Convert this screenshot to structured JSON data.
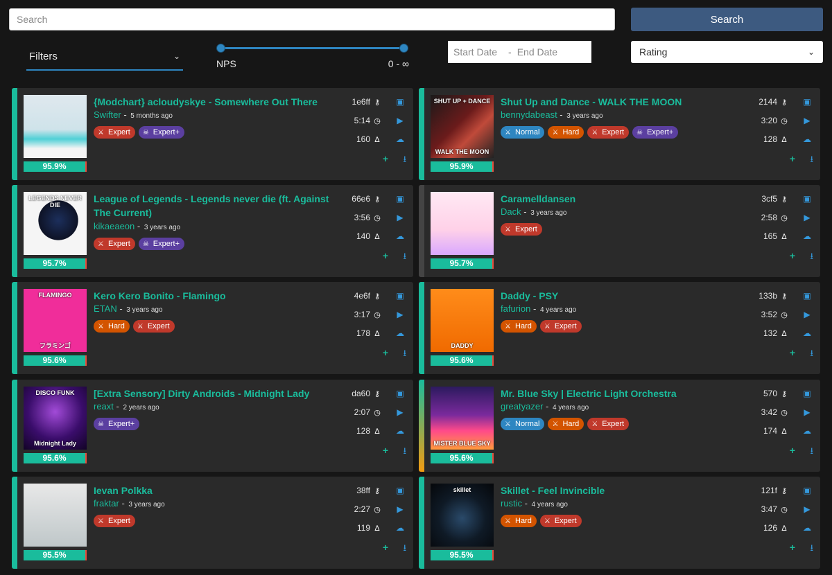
{
  "search": {
    "placeholder": "Search",
    "button_label": "Search"
  },
  "filters": {
    "label": "Filters"
  },
  "nps": {
    "label": "NPS",
    "range_text": "0 - ∞"
  },
  "dates": {
    "start_placeholder": "Start Date",
    "separator": "-",
    "end_placeholder": "End Date"
  },
  "sort": {
    "selected": "Rating"
  },
  "colors": {
    "accent": "#1abc9c",
    "link_blue": "#3498db",
    "search_button": "#3d5a80"
  },
  "maps": [
    {
      "title": "{Modchart} acloudyskye - Somewhere Out There",
      "mapper": "Swifter",
      "age": "5 months ago",
      "key": "1e6ff",
      "duration": "5:14",
      "bpm": "160",
      "rating": "95.9%",
      "rating_fraction": 0.959,
      "difficulties": [
        {
          "label": "Expert",
          "type": "Expert"
        },
        {
          "label": "Expert+",
          "type": "ExpertPlus"
        }
      ]
    },
    {
      "title": "Shut Up and Dance - WALK THE MOON",
      "mapper": "bennydabeast",
      "age": "3 years ago",
      "key": "2144",
      "duration": "3:20",
      "bpm": "128",
      "rating": "95.9%",
      "rating_fraction": 0.959,
      "difficulties": [
        {
          "label": "Normal",
          "type": "Normal"
        },
        {
          "label": "Hard",
          "type": "Hard"
        },
        {
          "label": "Expert",
          "type": "Expert"
        },
        {
          "label": "Expert+",
          "type": "ExpertPlus"
        }
      ]
    },
    {
      "title": "League of Legends - Legends never die (ft. Against The Current)",
      "mapper": "kikaeaeon",
      "age": "3 years ago",
      "key": "66e6",
      "duration": "3:56",
      "bpm": "140",
      "rating": "95.7%",
      "rating_fraction": 0.957,
      "difficulties": [
        {
          "label": "Expert",
          "type": "Expert"
        },
        {
          "label": "Expert+",
          "type": "ExpertPlus"
        }
      ]
    },
    {
      "title": "Caramelldansen",
      "mapper": "Dack",
      "age": "3 years ago",
      "key": "3cf5",
      "duration": "2:58",
      "bpm": "165",
      "rating": "95.7%",
      "rating_fraction": 0.957,
      "difficulties": [
        {
          "label": "Expert",
          "type": "Expert"
        }
      ]
    },
    {
      "title": "Kero Kero Bonito - Flamingo",
      "mapper": "ETAN",
      "age": "3 years ago",
      "key": "4e6f",
      "duration": "3:17",
      "bpm": "178",
      "rating": "95.6%",
      "rating_fraction": 0.956,
      "difficulties": [
        {
          "label": "Hard",
          "type": "Hard"
        },
        {
          "label": "Expert",
          "type": "Expert"
        }
      ]
    },
    {
      "title": "Daddy - PSY",
      "mapper": "fafurion",
      "age": "4 years ago",
      "key": "133b",
      "duration": "3:52",
      "bpm": "132",
      "rating": "95.6%",
      "rating_fraction": 0.956,
      "difficulties": [
        {
          "label": "Hard",
          "type": "Hard"
        },
        {
          "label": "Expert",
          "type": "Expert"
        }
      ]
    },
    {
      "title": "[Extra Sensory] Dirty Androids - Midnight Lady",
      "mapper": "reaxt",
      "age": "2 years ago",
      "key": "da60",
      "duration": "2:07",
      "bpm": "128",
      "rating": "95.6%",
      "rating_fraction": 0.956,
      "difficulties": [
        {
          "label": "Expert+",
          "type": "ExpertPlus"
        }
      ]
    },
    {
      "title": "Mr. Blue Sky | Electric Light Orchestra",
      "mapper": "greatyazer",
      "age": "4 years ago",
      "key": "570",
      "duration": "3:42",
      "bpm": "174",
      "rating": "95.6%",
      "rating_fraction": 0.956,
      "difficulties": [
        {
          "label": "Normal",
          "type": "Normal"
        },
        {
          "label": "Hard",
          "type": "Hard"
        },
        {
          "label": "Expert",
          "type": "Expert"
        }
      ]
    },
    {
      "title": "Ievan Polkka",
      "mapper": "fraktar",
      "age": "3 years ago",
      "key": "38ff",
      "duration": "2:27",
      "bpm": "119",
      "rating": "95.5%",
      "rating_fraction": 0.955,
      "difficulties": [
        {
          "label": "Expert",
          "type": "Expert"
        }
      ]
    },
    {
      "title": "Skillet - Feel Invincible",
      "mapper": "rustic",
      "age": "4 years ago",
      "key": "121f",
      "duration": "3:47",
      "bpm": "126",
      "rating": "95.5%",
      "rating_fraction": 0.955,
      "difficulties": [
        {
          "label": "Hard",
          "type": "Hard"
        },
        {
          "label": "Expert",
          "type": "Expert"
        }
      ]
    }
  ],
  "covers": [
    {
      "bg": "linear-gradient(#dfe8ee 0%, #cfe3ea 55%, #4fd0d6 70%, #f4f4f4 85%)"
    },
    {
      "bg": "linear-gradient(135deg, #1a1a1a 0%, #6b1b1b 45%, #c04a3a 65%, #222 100%)",
      "text": "SHUT UP + DANCE",
      "text2": "WALK THE MOON"
    },
    {
      "bg": "radial-gradient(circle at 55% 45%, #1c2f5c 0%, #0e1326 40%, #f5f5f5 41%, #f5f5f5 100%)",
      "text": "LEGENDS NEVER DIE"
    },
    {
      "bg": "linear-gradient(#ffe9f4 0%, #ffd1e8 60%, #d9a8ff 100%)"
    },
    {
      "bg": "#f02d9a",
      "text": "FLAMINGO",
      "text2": "フラミンゴ"
    },
    {
      "bg": "linear-gradient(#ff8c1a, #f06a00)",
      "text2": "DADDY"
    },
    {
      "bg": "radial-gradient(circle at 50% 40%, #a24bd8 0%, #3a0d6b 55%, #120326 100%)",
      "text": "DISCO FUNK",
      "text2": "Midnight Lady"
    },
    {
      "bg": "linear-gradient(#2c1a5e 0%, #7a2a9c 45%, #ff4a8a 70%, #ff9a3c 100%)",
      "text2": "MISTER BLUE SKY"
    },
    {
      "bg": "linear-gradient(#e8e8e8, #bfc7c9)"
    },
    {
      "bg": "radial-gradient(circle at 50% 55%, #2a4a6a 0%, #0f1a26 50%, #05070a 100%)",
      "text": "skillet"
    }
  ],
  "icons": {
    "key": "key-icon",
    "clock": "clock-icon",
    "metronome": "metronome-icon",
    "twitch": "twitch-icon",
    "play": "play-icon",
    "cloud": "cloud-download-icon",
    "add": "add-icon",
    "download": "download-icon"
  }
}
